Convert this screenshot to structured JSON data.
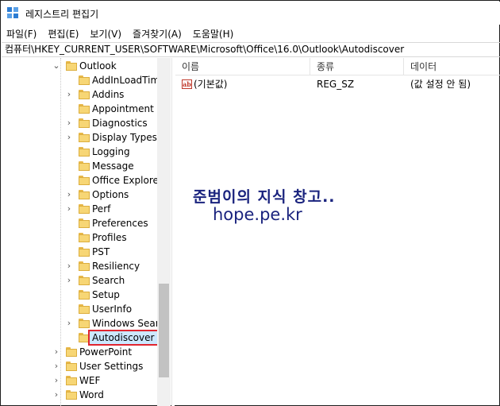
{
  "window": {
    "title": "레지스트리 편집기"
  },
  "menu": [
    "파일(F)",
    "편집(E)",
    "보기(V)",
    "즐겨찾기(A)",
    "도움말(H)"
  ],
  "address": "컴퓨터\\HKEY_CURRENT_USER\\SOFTWARE\\Microsoft\\Office\\16.0\\Outlook\\Autodiscover",
  "tree": {
    "parent": {
      "label": "Outlook",
      "expanded": true
    },
    "children": [
      {
        "label": "AddInLoadTimes",
        "expandable": false
      },
      {
        "label": "Addins",
        "expandable": true
      },
      {
        "label": "Appointment",
        "expandable": false
      },
      {
        "label": "Diagnostics",
        "expandable": true
      },
      {
        "label": "Display Types",
        "expandable": true
      },
      {
        "label": "Logging",
        "expandable": false
      },
      {
        "label": "Message",
        "expandable": false
      },
      {
        "label": "Office Explorer",
        "expandable": false
      },
      {
        "label": "Options",
        "expandable": true
      },
      {
        "label": "Perf",
        "expandable": true
      },
      {
        "label": "Preferences",
        "expandable": false
      },
      {
        "label": "Profiles",
        "expandable": false
      },
      {
        "label": "PST",
        "expandable": false
      },
      {
        "label": "Resiliency",
        "expandable": true
      },
      {
        "label": "Search",
        "expandable": true
      },
      {
        "label": "Setup",
        "expandable": false
      },
      {
        "label": "UserInfo",
        "expandable": false
      },
      {
        "label": "Windows Search",
        "expandable": true
      },
      {
        "label": "Autodiscover",
        "expandable": false,
        "selected": true
      }
    ],
    "siblings": [
      {
        "label": "PowerPoint",
        "expandable": true
      },
      {
        "label": "User Settings",
        "expandable": true
      },
      {
        "label": "WEF",
        "expandable": true
      },
      {
        "label": "Word",
        "expandable": true
      }
    ]
  },
  "list": {
    "columns": {
      "name": "이름",
      "type": "종류",
      "data": "데이터"
    },
    "rows": [
      {
        "name": "(기본값)",
        "type": "REG_SZ",
        "data": "(값 설정 안 됨)",
        "icon": "ab"
      }
    ]
  },
  "watermark": {
    "line1": "준범이의 지식 창고..",
    "line2": "hope.pe.kr"
  }
}
